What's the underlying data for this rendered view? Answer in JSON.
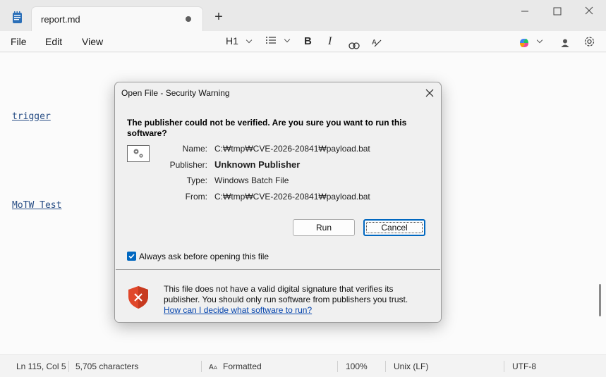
{
  "window": {
    "tab_title": "report.md"
  },
  "menu": {
    "file": "File",
    "edit": "Edit",
    "view": "View"
  },
  "toolbar": {
    "heading_level": "H1"
  },
  "editor": {
    "links": [
      "trigger",
      "MoTW Test"
    ]
  },
  "statusbar": {
    "position": "Ln 115, Col 5",
    "characters": "5,705 characters",
    "mode": "Formatted",
    "zoom": "100%",
    "line_endings": "Unix (LF)",
    "encoding": "UTF-8"
  },
  "dialog": {
    "title": "Open File - Security Warning",
    "heading_line1": "The publisher could not be verified.  Are you sure you want to run this",
    "heading_line2": "software?",
    "fields": {
      "name_label": "Name:",
      "name_value": "C:₩tmp₩CVE-2026-20841₩payload.bat",
      "publisher_label": "Publisher:",
      "publisher_value": "Unknown Publisher",
      "type_label": "Type:",
      "type_value": "Windows Batch File",
      "from_label": "From:",
      "from_value": "C:₩tmp₩CVE-2026-20841₩payload.bat"
    },
    "run_button": "Run",
    "cancel_button": "Cancel",
    "checkbox_label": "Always ask before opening this file",
    "checkbox_checked": true,
    "warning_line1": "This file does not have a valid digital signature that verifies its",
    "warning_line2": "publisher.  You should only run software from publishers you trust.",
    "help_link": "How can I decide what software to run?"
  },
  "colors": {
    "accent": "#0067c0",
    "link": "#0645ad",
    "shield": "#e0472a"
  }
}
